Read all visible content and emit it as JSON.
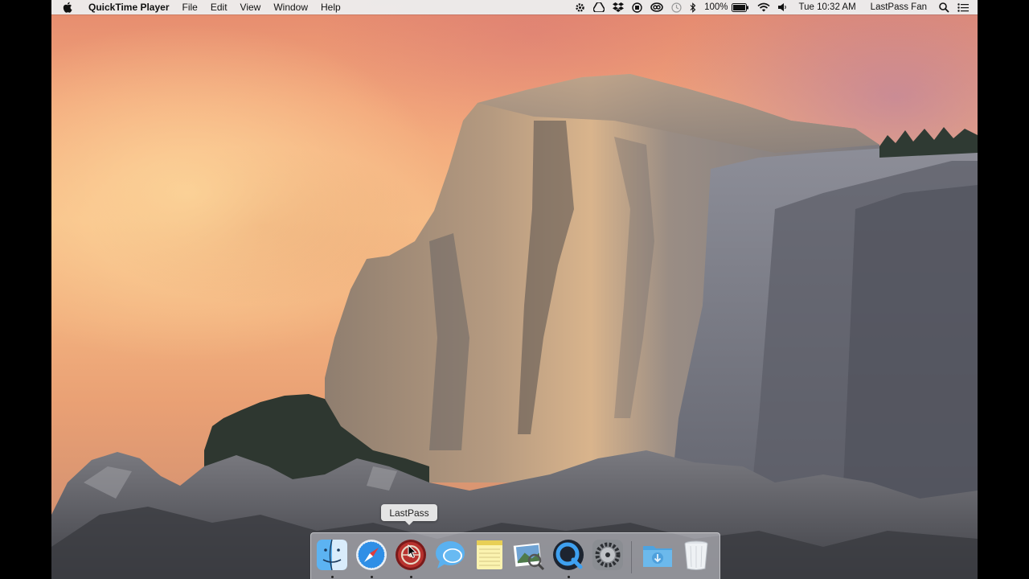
{
  "menubar": {
    "apple_icon": "apple-icon",
    "app_name": "QuickTime Player",
    "menus": [
      "File",
      "Edit",
      "View",
      "Window",
      "Help"
    ],
    "status": {
      "battery": "100%",
      "clock": "Tue 10:32 AM",
      "user": "LastPass Fan",
      "icons": [
        "gear-icon",
        "google-drive-icon",
        "dropbox-icon",
        "record-icon",
        "creative-cloud-icon",
        "time-machine-icon",
        "bluetooth-icon",
        "battery-icon",
        "wifi-icon",
        "volume-icon",
        "spotlight-icon",
        "notification-center-icon"
      ]
    }
  },
  "dock": {
    "tooltip": "LastPass",
    "apps": [
      {
        "name": "finder",
        "icon": "finder-icon",
        "running": true
      },
      {
        "name": "safari",
        "icon": "safari-icon",
        "running": true
      },
      {
        "name": "lastpass",
        "icon": "lastpass-icon",
        "running": true,
        "hovered": true
      },
      {
        "name": "messages",
        "icon": "messages-icon",
        "running": false
      },
      {
        "name": "notes",
        "icon": "notes-icon",
        "running": false
      },
      {
        "name": "preview",
        "icon": "preview-icon",
        "running": false
      },
      {
        "name": "quicktime",
        "icon": "quicktime-icon",
        "running": true
      },
      {
        "name": "system-preferences",
        "icon": "system-preferences-icon",
        "running": false
      }
    ],
    "stacks": [
      {
        "name": "downloads",
        "icon": "downloads-folder-icon"
      },
      {
        "name": "trash",
        "icon": "trash-icon"
      }
    ]
  },
  "wallpaper": "yosemite-half-dome"
}
